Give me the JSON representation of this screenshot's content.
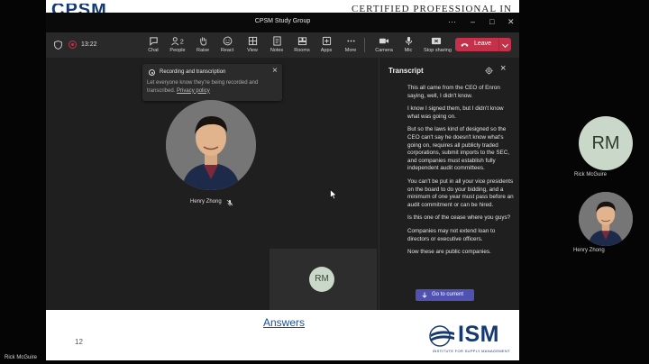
{
  "slide": {
    "top_logo": "CPSM",
    "top_title": "CERTIFIED PROFESSIONAL IN",
    "answers_link": "Answers",
    "page_number": "12",
    "ism_logo_text": "ISM",
    "ism_logo_subtitle": "INSTITUTE FOR SUPPLY MANAGEMENT",
    "brand_color": "#16396f"
  },
  "window": {
    "title": "CPSM Study Group",
    "controls": {
      "more": "···",
      "minimize": "–",
      "maximize": "□",
      "close": "✕"
    }
  },
  "toolbar": {
    "timer": "13:22",
    "people_count": "2",
    "buttons": [
      {
        "label": "Chat",
        "icon": "chat-icon"
      },
      {
        "label": "People",
        "icon": "people-icon"
      },
      {
        "label": "Raise",
        "icon": "raise-hand-icon"
      },
      {
        "label": "React",
        "icon": "react-icon"
      },
      {
        "label": "View",
        "icon": "view-icon"
      },
      {
        "label": "Notes",
        "icon": "notes-icon"
      },
      {
        "label": "Rooms",
        "icon": "rooms-icon"
      },
      {
        "label": "Apps",
        "icon": "apps-icon"
      },
      {
        "label": "More",
        "icon": "more-icon"
      }
    ],
    "media": [
      {
        "label": "Camera",
        "icon": "camera-icon"
      },
      {
        "label": "Mic",
        "icon": "mic-icon"
      },
      {
        "label": "Stop sharing",
        "icon": "share-icon"
      }
    ],
    "leave_label": "Leave",
    "leave_color": "#c4314b"
  },
  "banner": {
    "title": "Recording and transcription",
    "text": "Let everyone know they're being recorded and transcribed.",
    "link": "Privacy policy"
  },
  "stage": {
    "speaker_name": "Henry Zhong",
    "self_initials": "RM"
  },
  "transcript": {
    "title": "Transcript",
    "entries": [
      "This all came from the CEO of Enron saying, well, I didn't know.",
      "I know I signed them, but I didn't know what was going on.",
      "But so the laws kind of designed so the CEO can't say he doesn't know what's going on, requires all publicly traded corporations, submit imports to the SEC, and companies must establish fully independent audit committees.",
      "You can't be put in all your vice presidents on the board to do your bidding, and a minimum of one year must pass before an audit commitment or can be hired.",
      "Is this one of the cease where you guys?",
      "Companies may not extend loan to directors or executive officers.",
      "Now these are public companies."
    ],
    "go_current": "Go to current",
    "accent": "#4f52b2"
  },
  "gallery": {
    "rm_initials": "RM",
    "rm_name": "Rick McGuire",
    "henry_name": "Henry Zhong"
  },
  "footer": {
    "name": "Rick McGuire"
  }
}
